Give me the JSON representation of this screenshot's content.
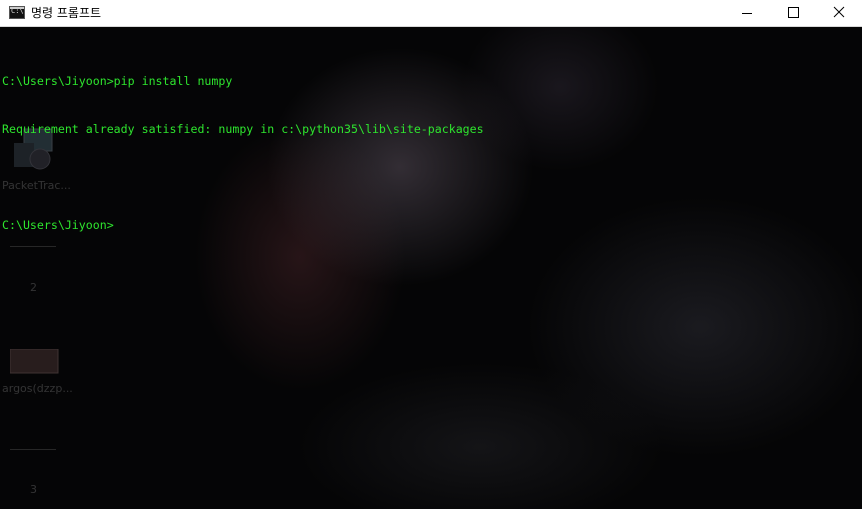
{
  "window": {
    "title": "명령 프롬프트",
    "icon": "cmd-icon",
    "controls": [
      "minimize-icon",
      "maximize-icon",
      "close-icon"
    ]
  },
  "console": {
    "text_color": "#2ee52e",
    "lines": [
      "",
      "C:\\Users\\Jiyoon>pip install numpy",
      "Requirement already satisfied: numpy in c:\\python35\\lib\\site-packages",
      "",
      "C:\\Users\\Jiyoon>"
    ]
  },
  "background": {
    "ghost_labels": [
      "PacketTrac...",
      "2",
      "argos(dzzp...",
      "3"
    ]
  }
}
